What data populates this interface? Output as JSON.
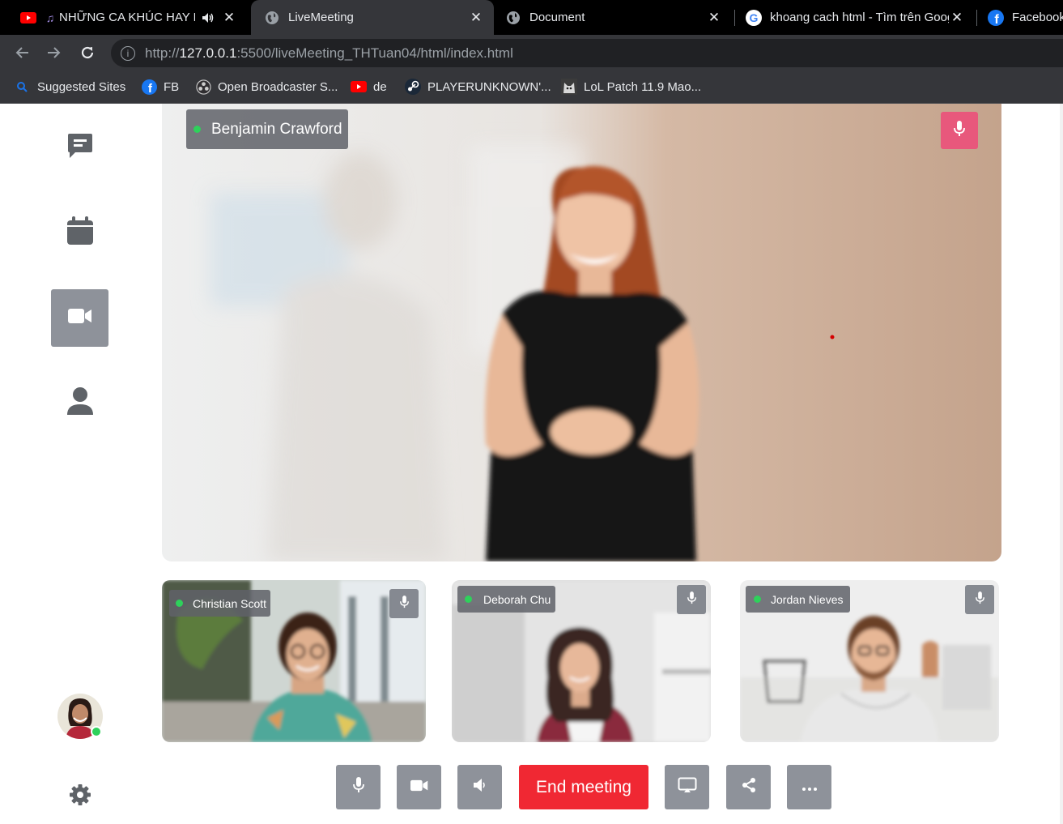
{
  "browser": {
    "tabs": [
      {
        "title": "NHỮNG CA KHÚC HAY NHẤT",
        "favicon": "youtube-icon",
        "audio": true
      },
      {
        "title": "LiveMeeting",
        "favicon": "globe-icon",
        "active": true
      },
      {
        "title": "Document",
        "favicon": "globe-icon"
      },
      {
        "title": "khoang cach html - Tìm trên Google",
        "favicon": "google-icon"
      },
      {
        "title": "Facebook",
        "favicon": "facebook-icon"
      }
    ],
    "url": {
      "scheme": "http://",
      "host": "127.0.0.1",
      "rest": ":5500/liveMeeting_THTuan04/html/index.html"
    },
    "bookmarks": [
      {
        "label": "Suggested Sites",
        "icon": "search-icon"
      },
      {
        "label": "FB",
        "icon": "facebook-icon"
      },
      {
        "label": "Open Broadcaster S...",
        "icon": "obs-icon"
      },
      {
        "label": "de",
        "icon": "youtube-icon"
      },
      {
        "label": "PLAYERUNKNOWN'...",
        "icon": "steam-icon"
      },
      {
        "label": "LoL Patch 11.9 Mao...",
        "icon": "cat-icon"
      }
    ]
  },
  "sidebar": {
    "items": [
      {
        "name": "chat",
        "icon": "chat-icon",
        "active": false
      },
      {
        "name": "calendar",
        "icon": "calendar-icon",
        "active": false
      },
      {
        "name": "video",
        "icon": "video-camera-icon",
        "active": true
      },
      {
        "name": "profile",
        "icon": "user-icon",
        "active": false
      }
    ],
    "self_status": "online",
    "settings_icon": "gear-icon"
  },
  "meeting": {
    "main_speaker": {
      "name": "Benjamin Crawford",
      "status": "online",
      "mic": "on"
    },
    "participants": [
      {
        "name": "Christian Scott",
        "status": "online",
        "mic": "on"
      },
      {
        "name": "Deborah Chu",
        "status": "online",
        "mic": "on"
      },
      {
        "name": "Jordan Nieves",
        "status": "online",
        "mic": "on"
      }
    ]
  },
  "controls": {
    "mic": "microphone-icon",
    "camera": "video-camera-icon",
    "speaker": "volume-icon",
    "end_label": "End meeting",
    "screen": "screen-share-icon",
    "share": "share-icon",
    "more": "more-icon"
  },
  "colors": {
    "accent_active": "#8e929a",
    "end_button": "#f02833",
    "mic_active": "#e8587c",
    "online": "#2ed15b"
  }
}
